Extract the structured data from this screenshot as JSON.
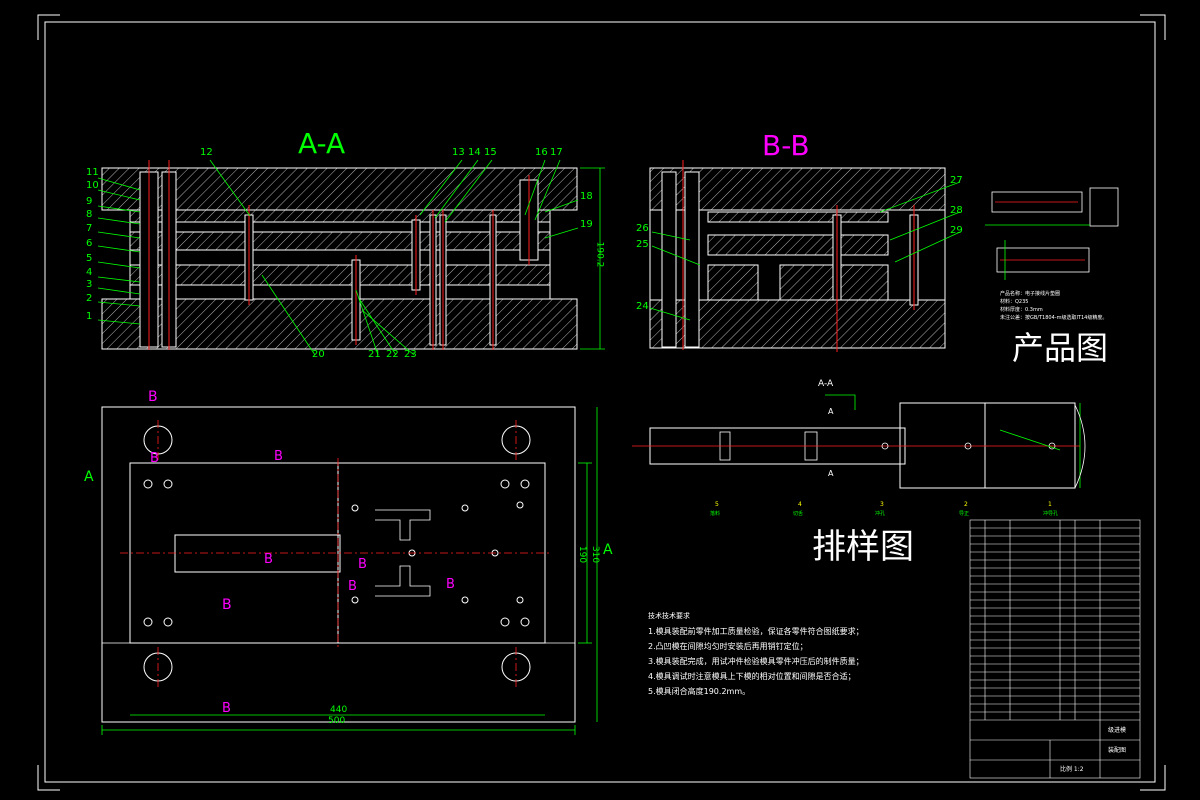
{
  "section_titles": {
    "aa": "A-A",
    "bb": "B-B",
    "product": "产品图",
    "layout": "排样图"
  },
  "part_numbers_left": [
    "11",
    "10",
    "9",
    "8",
    "7",
    "6",
    "5",
    "4",
    "3",
    "2",
    "1"
  ],
  "part_numbers_top": [
    "12",
    "13",
    "14",
    "15",
    "16",
    "17",
    "18",
    "19"
  ],
  "part_numbers_bottom": [
    "20",
    "21",
    "22",
    "23"
  ],
  "part_numbers_bb_left": [
    "26",
    "25",
    "24"
  ],
  "part_numbers_bb_right": [
    "27",
    "28",
    "29"
  ],
  "dimensions": {
    "height_190": "190.2",
    "width_440": "440",
    "width_500": "500",
    "side_190": "190",
    "side_310": "310"
  },
  "view_labels": {
    "a_left": "A",
    "a_right": "A",
    "b_top": "B",
    "b_mid": "B",
    "b_left_mark": "B",
    "b_right_mark": "B",
    "b_bottom": "B",
    "b_center": "B",
    "bl": "B",
    "br": "B",
    "aa_small": "A-A",
    "a_small_top": "A",
    "a_small_bottom": "A"
  },
  "product_notes": [
    "产品名称：电子接线片垫圈",
    "材料：Q235",
    "材料厚度：0.3mm",
    "未注公差：按GB/T1804-m级选取IT14级精度。"
  ],
  "tech_requirements": {
    "heading": "技术技术要求",
    "items": [
      "1.模具装配前零件加工质量检验，保证各零件符合图纸要求；",
      "2.凸凹模在间隙均匀时安装后再用销钉定位；",
      "3.模具装配完成，用试冲件检验模具零件冲压后的制件质量；",
      "4.模具调试时注意模具上下模的相对位置和间隙是否合适；",
      "5.模具闭合高度190.2mm。"
    ]
  },
  "layout_station_numbers": [
    "5",
    "4",
    "3",
    "2",
    "1"
  ],
  "layout_station_labels": [
    "落料",
    "切舌",
    "冲孔",
    "导正",
    "冲导孔"
  ],
  "title_block": {
    "drawing_name": "级进模",
    "label_a": "装配图",
    "label_b": "比例 1:2",
    "scale": "1:2"
  },
  "colors": {
    "background": "#000000",
    "outline": "#ffffff",
    "dimension": "#00ff00",
    "label": "#ff00ff",
    "centerline": "#ff0000",
    "hatch": "#ffffff"
  }
}
